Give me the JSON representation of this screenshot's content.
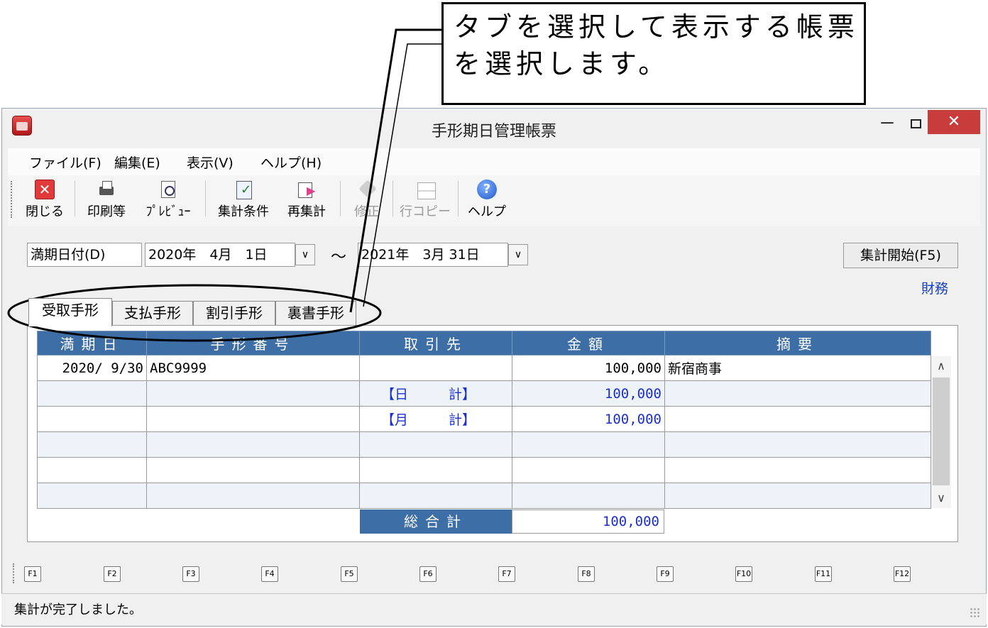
{
  "callout": {
    "text": "タブを選択して表示する帳票\nを選択します。"
  },
  "window": {
    "title": "手形期日管理帳票",
    "controls": {
      "minimize": "－",
      "close": "✕"
    }
  },
  "menu": [
    "ファイル(F)",
    "編集(E)",
    "表示(V)",
    "ヘルプ(H)"
  ],
  "toolbar": [
    {
      "label": "閉じる",
      "icon": "close-icon",
      "enabled": true
    },
    {
      "label": "印刷等",
      "icon": "printer-icon",
      "enabled": true
    },
    {
      "label": "ﾌﾟﾚﾋﾞｭｰ",
      "icon": "preview-icon",
      "enabled": true
    },
    {
      "label": "集計条件",
      "icon": "conditions-icon",
      "enabled": true
    },
    {
      "label": "再集計",
      "icon": "reaggregate-icon",
      "enabled": true
    },
    {
      "label": "修正",
      "icon": "eraser-icon",
      "enabled": false
    },
    {
      "label": "行コピー",
      "icon": "row-copy-icon",
      "enabled": false
    },
    {
      "label": "ヘルプ",
      "icon": "help-icon",
      "enabled": true,
      "glyph": "?"
    }
  ],
  "date_filter": {
    "label": "満期日付(D)",
    "from": "2020年　4月　1日",
    "to": "2021年　3月 31日",
    "separator": "～",
    "dropdown_glyph": "∨"
  },
  "run_button": "集計開始(F5)",
  "category_link": "財務",
  "tabs": [
    {
      "label": "受取手形",
      "active": true
    },
    {
      "label": "支払手形",
      "active": false
    },
    {
      "label": "割引手形",
      "active": false
    },
    {
      "label": "裏書手形",
      "active": false
    }
  ],
  "table": {
    "columns": [
      "満期日",
      "手形番号",
      "取引先",
      "金額",
      "摘要"
    ],
    "rows": [
      {
        "date": "2020/ 9/30",
        "number": "ABC9999",
        "partner": "",
        "amount": "100,000",
        "memo": "新宿商事"
      },
      {
        "date": "",
        "number": "",
        "partner": "【日　　　計】",
        "amount": "100,000",
        "memo": ""
      },
      {
        "date": "",
        "number": "",
        "partner": "【月　　　計】",
        "amount": "100,000",
        "memo": ""
      },
      {
        "date": "",
        "number": "",
        "partner": "",
        "amount": "",
        "memo": ""
      },
      {
        "date": "",
        "number": "",
        "partner": "",
        "amount": "",
        "memo": ""
      },
      {
        "date": "",
        "number": "",
        "partner": "",
        "amount": "",
        "memo": ""
      }
    ],
    "total_label": "総合計",
    "total_value": "100,000",
    "scroll": {
      "up": "∧",
      "down": "∨"
    }
  },
  "function_keys": [
    "F1",
    "F2",
    "F3",
    "F4",
    "F5",
    "F6",
    "F7",
    "F8",
    "F9",
    "F10",
    "F11",
    "F12"
  ],
  "status": "集計が完了しました。"
}
